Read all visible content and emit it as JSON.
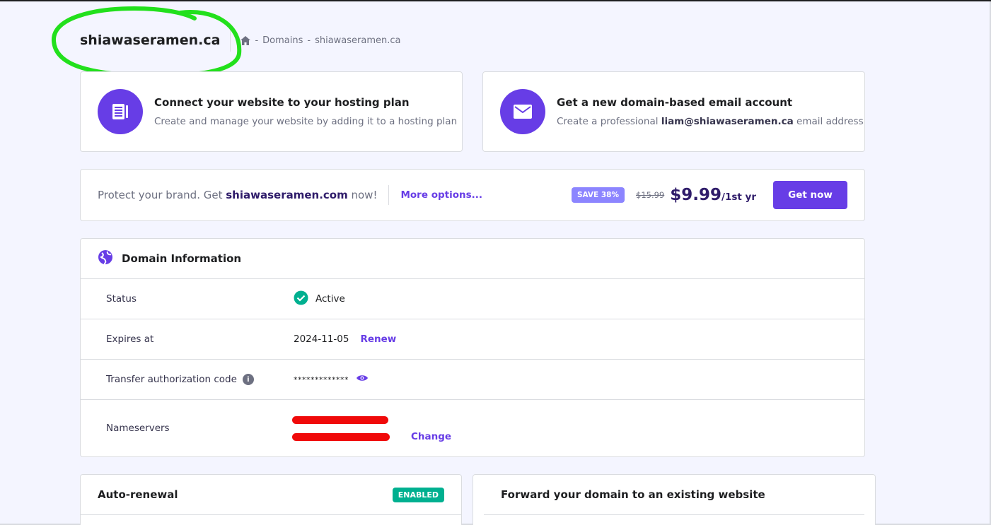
{
  "header": {
    "title": "shiawaseramen.ca",
    "breadcrumb": [
      "Domains",
      "shiawaseramen.ca"
    ],
    "separator": "-"
  },
  "promos": {
    "hosting": {
      "icon": "website-list-icon",
      "title": "Connect your website to your hosting plan",
      "text": "Create and manage your website by adding it to a hosting plan"
    },
    "email": {
      "icon": "mail-icon",
      "title": "Get a new domain-based email account",
      "text_before": "Create a professional ",
      "text_bold": "liam@shiawaseramen.ca",
      "text_after": " email address"
    }
  },
  "upsell": {
    "text_before": "Protect your brand. Get ",
    "domain": "shiawaseramen.com",
    "text_after": " now!",
    "more_options": "More options...",
    "save_badge": "SAVE 38%",
    "old_price": "$15.99",
    "price": "$9.99",
    "period": "/1st yr",
    "cta": "Get now"
  },
  "domain_info": {
    "title": "Domain Information",
    "rows": {
      "status": {
        "label": "Status",
        "value": "Active"
      },
      "expires": {
        "label": "Expires at",
        "value": "2024-11-05",
        "action": "Renew"
      },
      "auth_code": {
        "label": "Transfer authorization code",
        "value": "*************"
      },
      "nameservers": {
        "label": "Nameservers",
        "action": "Change"
      }
    }
  },
  "auto_renewal": {
    "title": "Auto-renewal",
    "badge": "ENABLED"
  },
  "forward": {
    "title": "Forward your domain to an existing website"
  },
  "colors": {
    "accent": "#673de6",
    "success": "#00b090",
    "annotation": "#22e01c",
    "redaction": "#f00a0a"
  }
}
